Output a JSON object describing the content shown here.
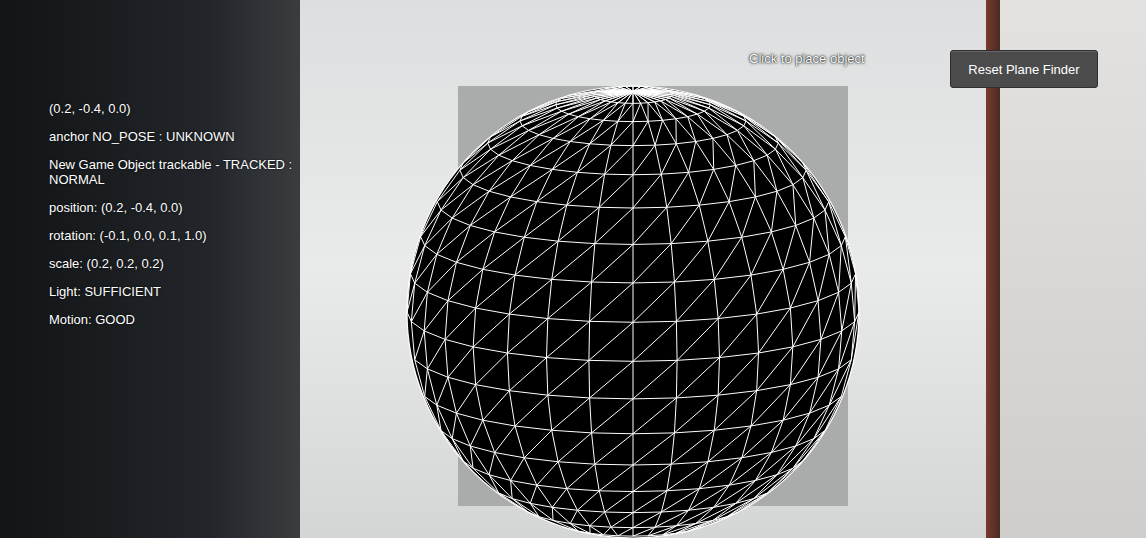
{
  "debug_lines": [
    {
      "text": "(0.2, -0.4, 0.0)"
    },
    {
      "text": "anchor NO_POSE : UNKNOWN"
    },
    {
      "text": "New Game Object trackable - TRACKED : NORMAL"
    },
    {
      "text": "position: (0.2, -0.4, 0.0)"
    },
    {
      "text": "rotation: (-0.1, 0.0, 0.1, 1.0)"
    },
    {
      "text": "scale: (0.2, 0.2, 0.2)"
    },
    {
      "text": "Light: SUFFICIENT"
    },
    {
      "text": "Motion: GOOD"
    }
  ],
  "hint": "Click to place object",
  "buttons": [
    "Reset Plane Finder"
  ]
}
